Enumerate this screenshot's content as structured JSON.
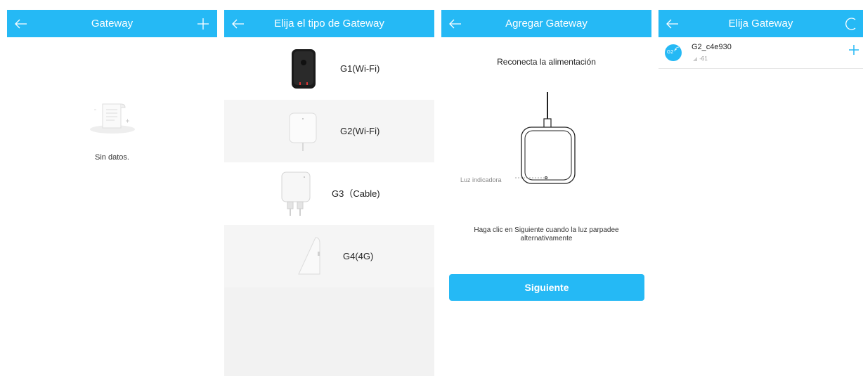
{
  "screens": {
    "gateway": {
      "title": "Gateway",
      "empty_text": "Sin datos."
    },
    "choose_type": {
      "title": "Elija el tipo de Gateway",
      "items": [
        {
          "label": "G1(Wi-Fi)"
        },
        {
          "label": "G2(Wi-Fi)"
        },
        {
          "label": "G3（Cable)"
        },
        {
          "label": "G4(4G)"
        }
      ]
    },
    "add_gateway": {
      "title": "Agregar Gateway",
      "reconnect": "Reconecta la alimentación",
      "indicator_label": "Luz indicadora",
      "hint": "Haga clic en Siguiente cuando la luz parpadee alternativamente",
      "next_button": "Siguiente"
    },
    "choose_gateway": {
      "title": "Elija Gateway",
      "devices": [
        {
          "name": "G2_c4e930",
          "avatar_label": "G2",
          "signal": "-61"
        }
      ]
    }
  },
  "colors": {
    "accent": "#25b9f5"
  },
  "icons": [
    "back-arrow-icon",
    "plus-icon",
    "refresh-icon",
    "empty-document-icon",
    "wifi-signal-icon"
  ]
}
